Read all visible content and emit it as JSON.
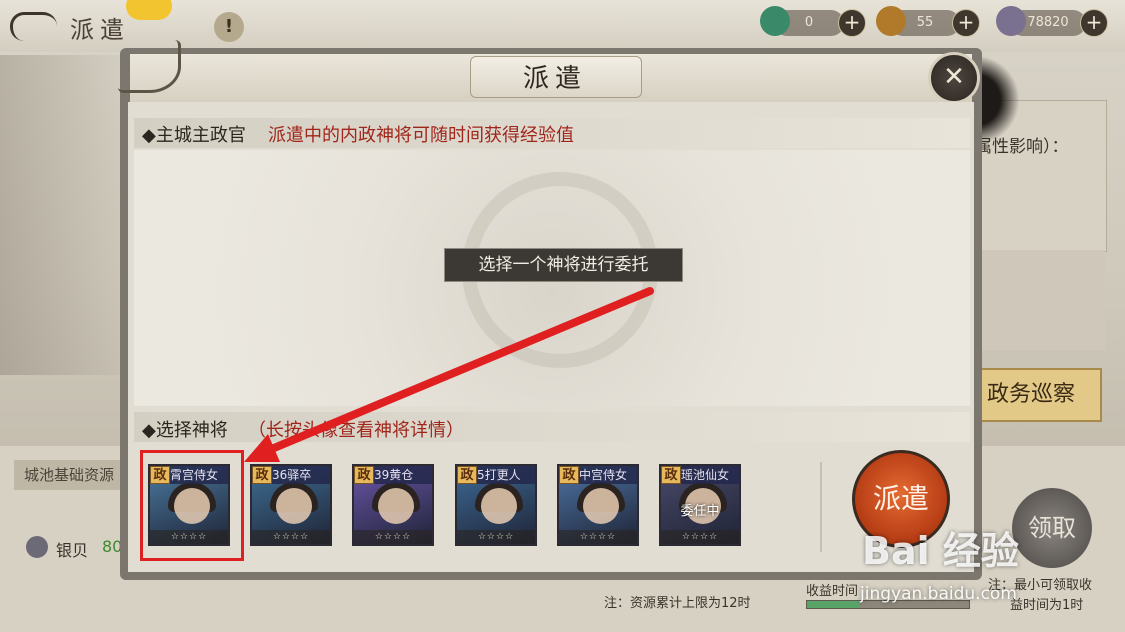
{
  "background": {
    "screen_title": "派遣",
    "warning_icon": "!",
    "resources": [
      {
        "icon": "jade-coin-icon",
        "value": "0",
        "color": "#3a8a6a"
      },
      {
        "icon": "copper-coin-icon",
        "value": "55",
        "color": "#b07a2a"
      },
      {
        "icon": "silver-coin-icon",
        "value": "78820",
        "color": "#7a7090"
      }
    ],
    "right_panel_text": "属性影响）：",
    "patrol_button": "政务巡察",
    "base_resource_label": "城池基础资源",
    "silver_label": "银贝",
    "silver_value": "80",
    "claim_button": "领取",
    "note_min_1": "注：最小可领取收",
    "note_min_2": "益时间为1时",
    "income_label": "收益时间",
    "income_progress": 0.33,
    "note_cap": "注：资源累计上限为12时"
  },
  "dialog": {
    "title": "派遣",
    "close_icon": "✕",
    "section1_title": "◆主城主政官",
    "section1_desc": "派遣中的内政神将可随时间获得经验值",
    "select_prompt": "选择一个神将进行委托",
    "section2_title": "◆选择神将",
    "section2_hint": "（长按头像查看神将详情）",
    "dispatch_button": "派遣",
    "cards": [
      {
        "tag": "政",
        "name": "霄宫侍女",
        "stars": "☆☆☆☆",
        "status": "",
        "bg": "#4a7aa0"
      },
      {
        "tag": "政",
        "name": "36驿卒",
        "stars": "☆☆☆☆",
        "status": "",
        "bg": "#3f6f95"
      },
      {
        "tag": "政",
        "name": "39黄仓",
        "stars": "☆☆☆☆",
        "status": "",
        "bg": "#6a55a8"
      },
      {
        "tag": "政",
        "name": "5打更人",
        "stars": "☆☆☆☆",
        "status": "",
        "bg": "#3d6a95"
      },
      {
        "tag": "政",
        "name": "中宫侍女",
        "stars": "☆☆☆☆",
        "status": "",
        "bg": "#4d74a4"
      },
      {
        "tag": "政",
        "name": "瑶池仙女",
        "stars": "☆☆☆☆",
        "status": "委任中",
        "bg": "#4a4a6a"
      }
    ]
  },
  "watermark": {
    "logo": "Bai 经验",
    "url": "jingyan.baidu.com"
  },
  "colors": {
    "highlight": "#e02020",
    "accent_red": "#a0261c"
  }
}
